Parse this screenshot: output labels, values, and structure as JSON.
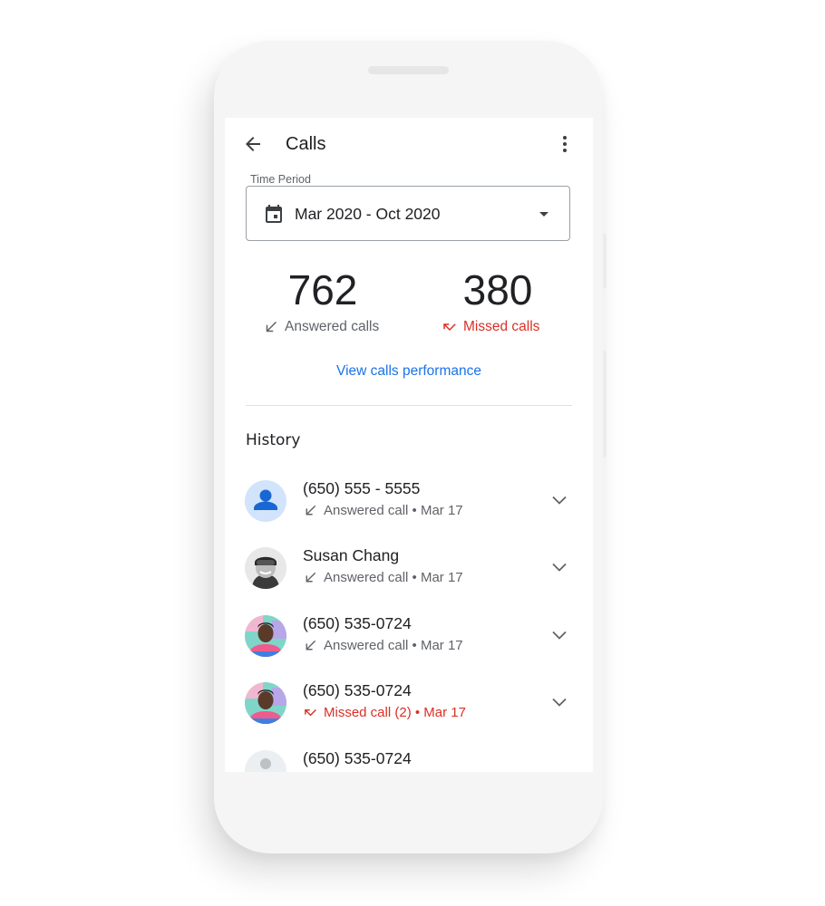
{
  "app_bar": {
    "title": "Calls",
    "back_icon": "arrow-back-icon",
    "menu_icon": "more-vert-icon"
  },
  "time_period": {
    "label": "Time Period",
    "value": "Mar 2020 - Oct 2020",
    "leading_icon": "calendar-icon",
    "trailing_icon": "dropdown-arrow-icon"
  },
  "stats": {
    "answered": {
      "count": "762",
      "label": "Answered calls",
      "icon": "call-received-icon"
    },
    "missed": {
      "count": "380",
      "label": "Missed calls",
      "icon": "call-missed-icon"
    }
  },
  "performance_link": "View calls performance",
  "history": {
    "title": "History",
    "items": [
      {
        "name": "(650) 555 - 5555",
        "status": "Answered call • Mar 17",
        "type": "answered",
        "avatar": "generic-person"
      },
      {
        "name": "Susan Chang",
        "status": "Answered call • Mar 17",
        "type": "answered",
        "avatar": "photo-susan"
      },
      {
        "name": "(650) 535-0724",
        "status": "Answered call • Mar 17",
        "type": "answered",
        "avatar": "photo-man"
      },
      {
        "name": "(650) 535-0724",
        "status": "Missed call (2) • Mar 17",
        "type": "missed",
        "avatar": "photo-man"
      },
      {
        "name": "(650) 535-0724",
        "status": "",
        "type": "unknown",
        "avatar": "placeholder"
      }
    ]
  },
  "colors": {
    "accent": "#1a73e8",
    "missed": "#d93025",
    "text_primary": "#202124",
    "text_secondary": "#5f6368"
  }
}
